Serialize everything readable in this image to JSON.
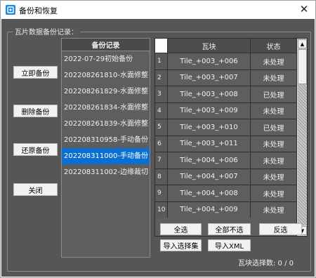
{
  "window": {
    "title": "备份和恢复",
    "close_glyph": "✕"
  },
  "group": {
    "title": "瓦片数据备份记录："
  },
  "side_buttons": {
    "backup_now": "立即备份",
    "delete_backup": "删除备份",
    "restore_backup": "还原备份",
    "close": "关闭"
  },
  "backup_list": {
    "header": "备份记录",
    "items": [
      "2022-07-29初始备份",
      "202208261810-水面修整",
      "202208261829-水面修整",
      "202208261834-水面修整",
      "202208261839-水面修整",
      "202208310958-手动备份",
      "202208311000-手动备份",
      "202208311002-边缘裁切"
    ],
    "selected_index": 6
  },
  "tile_grid": {
    "columns": [
      "瓦块",
      "状态"
    ],
    "rows": [
      {
        "index": "1",
        "tile": "Tile_+003_+006",
        "status": "未处理"
      },
      {
        "index": "2",
        "tile": "Tile_+003_+007",
        "status": "未处理"
      },
      {
        "index": "3",
        "tile": "Tile_+003_+008",
        "status": "已处理"
      },
      {
        "index": "4",
        "tile": "Tile_+003_+009",
        "status": "未处理"
      },
      {
        "index": "5",
        "tile": "Tile_+003_+010",
        "status": "已处理"
      },
      {
        "index": "6",
        "tile": "Tile_+003_+011",
        "status": "未处理"
      },
      {
        "index": "7",
        "tile": "Tile_+004_+006",
        "status": "未处理"
      },
      {
        "index": "8",
        "tile": "Tile_+004_+007",
        "status": "未处理"
      },
      {
        "index": "9",
        "tile": "Tile_+004_+008",
        "status": "未处理"
      },
      {
        "index": "10",
        "tile": "Tile_+004_+009",
        "status": "未处理"
      }
    ],
    "scroll_up_glyph": "▲",
    "scroll_down_glyph": "▼"
  },
  "actions": {
    "select_all": "全选",
    "select_none": "全部不选",
    "invert": "反选",
    "import_selection": "导入选择集",
    "import_xml": "导入XML"
  },
  "footer": {
    "selection_count": "瓦块选择数: 0 / 0"
  },
  "colors": {
    "client_bg": "#565656",
    "selected": "#0b6fd1",
    "app_icon": "#1e88e5"
  },
  "icons": {
    "app": "backup-app-icon",
    "close": "close-icon"
  }
}
